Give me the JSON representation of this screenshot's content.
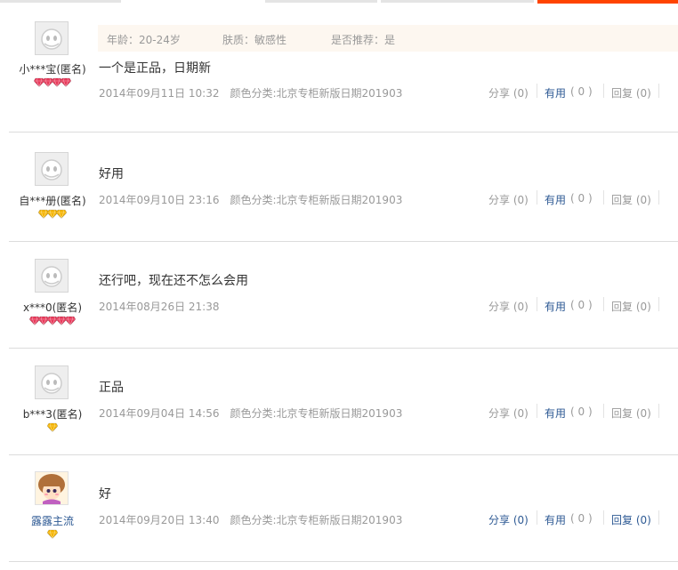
{
  "tags": {
    "age": "年龄：20-24岁",
    "skin": "肤质：敏感性",
    "recommend": "是否推荐：是"
  },
  "reviews": [
    {
      "user": "小***宝(匿名)",
      "content": "一个是正品，日期新",
      "date": "2014年09月11日 10:32",
      "sku": "颜色分类:北京专柜新版日期201903",
      "badge": "red-diamond",
      "badge_count": 4,
      "share": "分享 (0)",
      "useful_label": "有用",
      "useful_count": "( 0 )",
      "reply": "回复 (0)"
    },
    {
      "user": "自***册(匿名)",
      "content": "好用",
      "date": "2014年09月10日 23:16",
      "sku": "颜色分类:北京专柜新版日期201903",
      "badge": "yellow-diamond",
      "badge_count": 3,
      "share": "分享 (0)",
      "useful_label": "有用",
      "useful_count": "( 0 )",
      "reply": "回复 (0)"
    },
    {
      "user": "x***0(匿名)",
      "content": "还行吧，现在还不怎么会用",
      "date": "2014年08月26日 21:38",
      "sku": "",
      "badge": "red-diamond",
      "badge_count": 5,
      "share": "分享 (0)",
      "useful_label": "有用",
      "useful_count": "( 0 )",
      "reply": "回复 (0)"
    },
    {
      "user": "b***3(匿名)",
      "content": "正品",
      "date": "2014年09月04日 14:56",
      "sku": "颜色分类:北京专柜新版日期201903",
      "badge": "yellow-diamond",
      "badge_count": 1,
      "share": "分享 (0)",
      "useful_label": "有用",
      "useful_count": "( 0 )",
      "reply": "回复 (0)"
    },
    {
      "user": "露露主流",
      "content": "好",
      "date": "2014年09月20日 13:40",
      "sku": "颜色分类:北京专柜新版日期201903",
      "badge": "yellow-diamond",
      "badge_count": 1,
      "share": "分享 (0)",
      "useful_label": "有用",
      "useful_count": "( 0 )",
      "reply": "回复 (0)"
    }
  ],
  "colors": {
    "accent": "#ff4400",
    "link": "#2e5a94",
    "muted": "#999999",
    "text": "#333333",
    "tag_bg": "#fdf7f0",
    "red_diamond": "#e8395a",
    "yellow_diamond": "#f5b400"
  }
}
